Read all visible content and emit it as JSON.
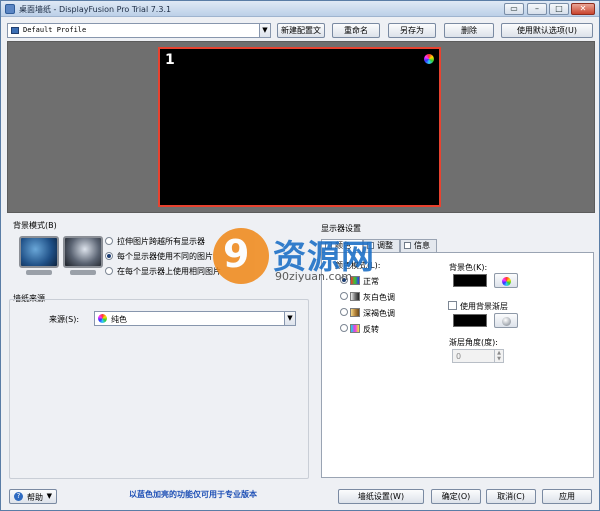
{
  "window": {
    "title": "桌面墙纸 - DisplayFusion Pro Trial 7.3.1"
  },
  "toolbar": {
    "profile": "Default Profile",
    "new_profile": "新建配置文",
    "rename": "重命名",
    "save_as": "另存为",
    "delete": "删除",
    "use_default": "使用默认选项(U)"
  },
  "monitor": {
    "number": "1"
  },
  "bg_mode": {
    "label": "背景模式(B)",
    "options": [
      "拉伸图片跨越所有显示器",
      "每个显示器使用不同的图片",
      "在每个显示器上使用相同图片"
    ],
    "selected_index": 1
  },
  "wallpaper_source": {
    "label": "墙纸来源",
    "source_label": "来源(S):",
    "source_value": "纯色"
  },
  "display_settings": {
    "label": "显示器设置",
    "tabs": [
      "颜色",
      "调整",
      "信息"
    ],
    "color_mode_label": "颜色模式(L):",
    "color_modes": [
      "正常",
      "灰白色调",
      "深褐色调",
      "反转"
    ],
    "selected_mode_index": 0,
    "bg_color_label": "背景色(K):",
    "bg_color": "#000000",
    "use_gradient_label": "使用背景渐层",
    "gradient_color": "#000000",
    "gradient_angle_label": "渐层角度(度):",
    "gradient_angle_value": "0"
  },
  "footer": {
    "help": "帮助",
    "note": "以蓝色加亮的功能仅可用于专业版本",
    "wallpaper_settings": "墙纸设置(W)",
    "ok": "确定(O)",
    "cancel": "取消(C)",
    "apply": "应用"
  },
  "watermark": {
    "logo": "9",
    "text": "资源网",
    "url": "90ziyuan.com"
  },
  "colors": {
    "monitor_border": "#e8422f",
    "note_blue": "#1d4fb5",
    "monitor_area": "#6f6f6f"
  }
}
